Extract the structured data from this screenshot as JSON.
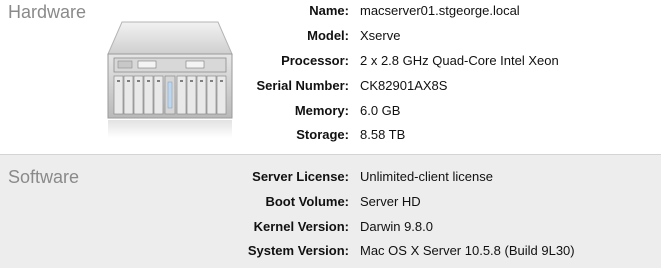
{
  "hardware": {
    "title": "Hardware",
    "rows": [
      {
        "label": "Name:",
        "value": "macserver01.stgeorge.local"
      },
      {
        "label": "Model:",
        "value": "Xserve"
      },
      {
        "label": "Processor:",
        "value": "2 x 2.8 GHz Quad-Core Intel Xeon"
      },
      {
        "label": "Serial Number:",
        "value": "CK82901AX8S"
      },
      {
        "label": "Memory:",
        "value": "6.0 GB"
      },
      {
        "label": "Storage:",
        "value": "8.58 TB"
      }
    ],
    "image_icon": "xserve-server-icon"
  },
  "software": {
    "title": "Software",
    "rows": [
      {
        "label": "Server License:",
        "value": "Unlimited-client license"
      },
      {
        "label": "Boot Volume:",
        "value": "Server HD"
      },
      {
        "label": "Kernel Version:",
        "value": "Darwin 9.8.0"
      },
      {
        "label": "System Version:",
        "value": "Mac OS X Server 10.5.8 (Build 9L30)"
      }
    ]
  },
  "colors": {
    "section_title": "#8a8a8a",
    "software_bg": "#ededed",
    "divider": "#d4d4d4"
  }
}
